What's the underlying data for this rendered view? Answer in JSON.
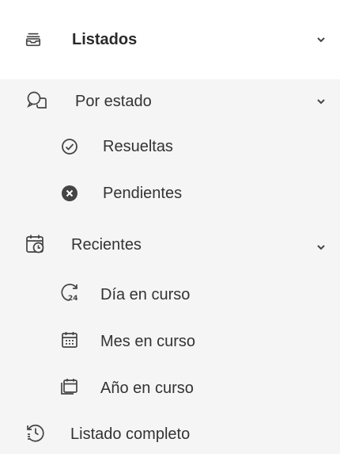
{
  "menu": {
    "header": {
      "label": "Listados",
      "icon": "inbox-icon",
      "expanded": true
    },
    "groups": [
      {
        "label": "Por estado",
        "icon": "chat-bubbles-icon",
        "expanded": true,
        "items": [
          {
            "label": "Resueltas",
            "icon": "check-circle-icon"
          },
          {
            "label": "Pendientes",
            "icon": "x-circle-filled-icon"
          }
        ]
      },
      {
        "label": "Recientes",
        "icon": "calendar-clock-icon",
        "expanded": true,
        "items": [
          {
            "label": "Día en curso",
            "icon": "clock-24-icon"
          },
          {
            "label": "Mes en curso",
            "icon": "calendar-month-icon"
          },
          {
            "label": "Año en curso",
            "icon": "calendar-stack-icon"
          }
        ]
      }
    ],
    "footer_item": {
      "label": "Listado completo",
      "icon": "history-icon"
    }
  },
  "colors": {
    "text": "#333333",
    "icon": "#444444",
    "body_background": "#f5f5f5",
    "header_background": "#ffffff"
  }
}
